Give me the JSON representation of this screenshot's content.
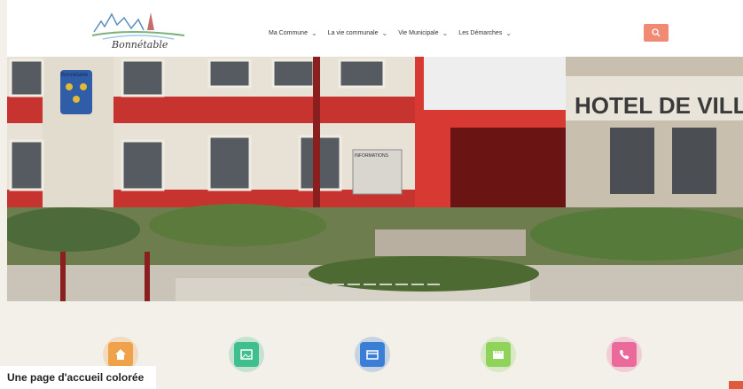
{
  "header": {
    "logo_text": "Bonnétable",
    "nav": [
      {
        "label": "Ma Commune"
      },
      {
        "label": "La vie communale"
      },
      {
        "label": "Vie Municipale"
      },
      {
        "label": "Les Démarches"
      }
    ]
  },
  "hero": {
    "coat_of_arms_label": "Bonnétable",
    "sign_text": "HOTEL DE VILL",
    "info_panel_text": "INFORMATIONS"
  },
  "features": {
    "tiles": [
      {
        "icon": "home-icon",
        "color": "#f0a24a"
      },
      {
        "icon": "image-icon",
        "color": "#3fbf8e"
      },
      {
        "icon": "card-icon",
        "color": "#3a7fd5"
      },
      {
        "icon": "film-icon",
        "color": "#8fd35a"
      },
      {
        "icon": "phone-icon",
        "color": "#ea6a9c"
      }
    ]
  },
  "caption": "Une page d'accueil colorée",
  "colors": {
    "accent": "#f08a74"
  }
}
